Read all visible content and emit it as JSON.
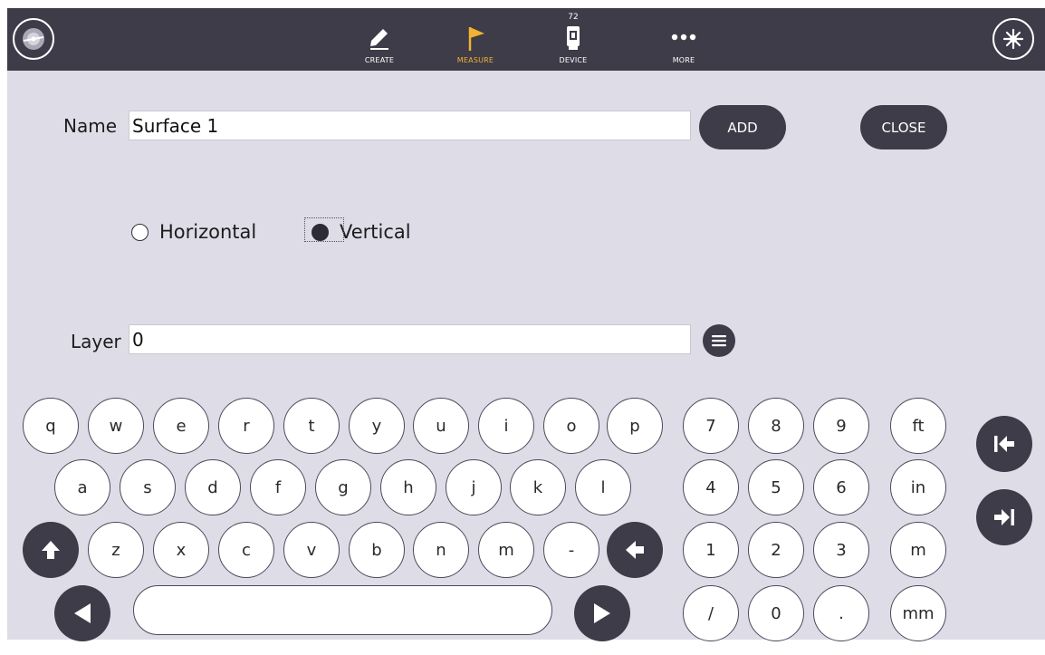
{
  "topbar": {
    "nav": [
      {
        "label": "CREATE",
        "icon": "pencil-icon"
      },
      {
        "label": "MEASURE",
        "icon": "flag-icon"
      },
      {
        "label": "DEVICE",
        "icon": "total-station-icon",
        "badge": "72"
      },
      {
        "label": "MORE",
        "icon": "more-dots-icon"
      }
    ],
    "left_icon": "compass-icon",
    "right_icon": "laser-burst-icon",
    "active_color": "#f2b132"
  },
  "form": {
    "name_label": "Name",
    "name_value": "Surface 1",
    "add_label": "ADD",
    "close_label": "CLOSE",
    "orientation": {
      "options": [
        "Horizontal",
        "Vertical"
      ],
      "selected": "Vertical"
    },
    "layer_label": "Layer",
    "layer_value": "0"
  },
  "keyboard": {
    "row1": [
      "q",
      "w",
      "e",
      "r",
      "t",
      "y",
      "u",
      "i",
      "o",
      "p"
    ],
    "row2": [
      "a",
      "s",
      "d",
      "f",
      "g",
      "h",
      "j",
      "k",
      "l"
    ],
    "row3": [
      "z",
      "x",
      "c",
      "v",
      "b",
      "n",
      "m",
      "-"
    ],
    "numpad": [
      [
        "7",
        "8",
        "9",
        "ft"
      ],
      [
        "4",
        "5",
        "6",
        "in"
      ],
      [
        "1",
        "2",
        "3",
        "m"
      ],
      [
        "/",
        "0",
        ".",
        "mm"
      ]
    ]
  },
  "colors": {
    "dark": "#3d3c48",
    "panel": "#dddce7",
    "accent": "#f2b132"
  }
}
